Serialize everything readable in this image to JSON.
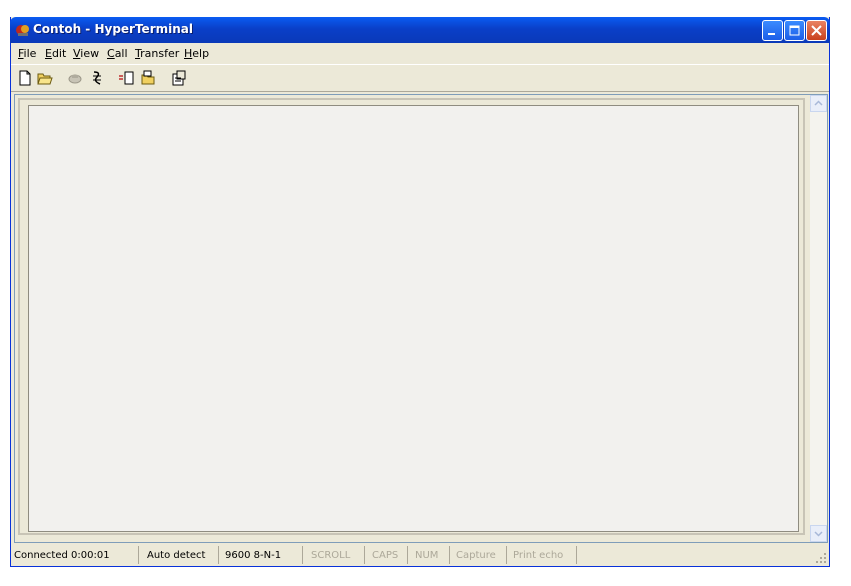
{
  "window": {
    "title": "Contoh - HyperTerminal"
  },
  "menu": {
    "items": [
      {
        "ul": "F",
        "rest": "ile"
      },
      {
        "ul": "E",
        "rest": "dit"
      },
      {
        "ul": "V",
        "rest": "iew"
      },
      {
        "ul": "C",
        "rest": "all"
      },
      {
        "ul": "T",
        "rest": "ransfer"
      },
      {
        "ul": "H",
        "rest": "elp"
      }
    ]
  },
  "toolbar": {
    "icons": [
      "new-file-icon",
      "open-folder-icon",
      "connect-icon",
      "disconnect-icon",
      "send-icon",
      "receive-icon",
      "properties-icon"
    ]
  },
  "status": {
    "connected": "Connected 0:00:01",
    "detect": "Auto detect",
    "settings": "9600 8-N-1",
    "scroll": "SCROLL",
    "caps": "CAPS",
    "num": "NUM",
    "capture": "Capture",
    "print_echo": "Print echo"
  },
  "colors": {
    "titlebar": "#0a5cf2",
    "chrome": "#ece9d8",
    "close": "#c9401c"
  }
}
